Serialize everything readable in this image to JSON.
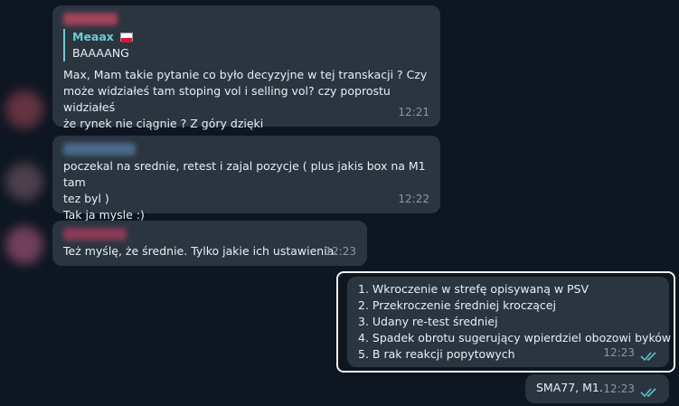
{
  "messages": [
    {
      "reply_to": {
        "name": "Meaax",
        "text": "BAAAANG"
      },
      "lines": [
        "Max, Mam takie pytanie co było decyzyjne w tej transkacji ? Czy",
        "może  widziałeś tam stoping vol i selling vol? czy poprostu widziałeś",
        "że rynek nie ciągnie ? Z góry dzięki"
      ],
      "time": "12:21"
    },
    {
      "lines": [
        "poczekal na srednie, retest i zajal pozycje ( plus jakis box na M1 tam",
        "tez byl )",
        "Tak ja mysle :)"
      ],
      "time": "12:22"
    },
    {
      "lines": [
        "Też myślę, że średnie. Tylko jakie ich ustawienia."
      ],
      "time": "12:23"
    },
    {
      "lines": [
        "1. Wkroczenie w strefę opisywaną w PSV",
        "2. Przekroczenie średniej kroczącej",
        "3. Udany re-test średniej",
        "4. Spadek obrotu sugerujący wpierdziel obozowi byków",
        "5. B rak reakcji popytowych"
      ],
      "time": "12:23"
    },
    {
      "lines": [
        "SMA77, M1."
      ],
      "time": "12:23"
    }
  ],
  "colors": {
    "background": "#0e1621",
    "bubble": "#2b3540",
    "accent": "#6fcbd1",
    "read_ticks": "#5fc1c7"
  },
  "icons": {
    "read_receipt": "double-check-icon",
    "flag": "poland-flag-icon"
  }
}
